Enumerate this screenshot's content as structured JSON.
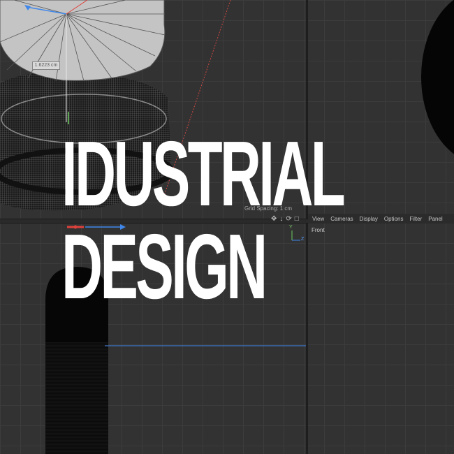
{
  "headline": {
    "line1": "IDUSTRIAL",
    "line2": "DESIGN"
  },
  "viewport": {
    "measurement": "1.6223 cm",
    "grid_label": "Grid Spacing: 1 cm",
    "front_label": "Front",
    "axis_y": "Y",
    "axis_z": "Z"
  },
  "menu": [
    "View",
    "Cameras",
    "Display",
    "Options",
    "Filter",
    "Panel"
  ],
  "icons": [
    "move-icon",
    "down-arrow-icon",
    "rotate-icon",
    "maximize-icon"
  ],
  "colors": {
    "background": "#323233",
    "grid": "#3c3c3d",
    "x_axis": "#e0413b",
    "z_axis": "#3f87ea",
    "y_axis": "#6fcf5f"
  }
}
